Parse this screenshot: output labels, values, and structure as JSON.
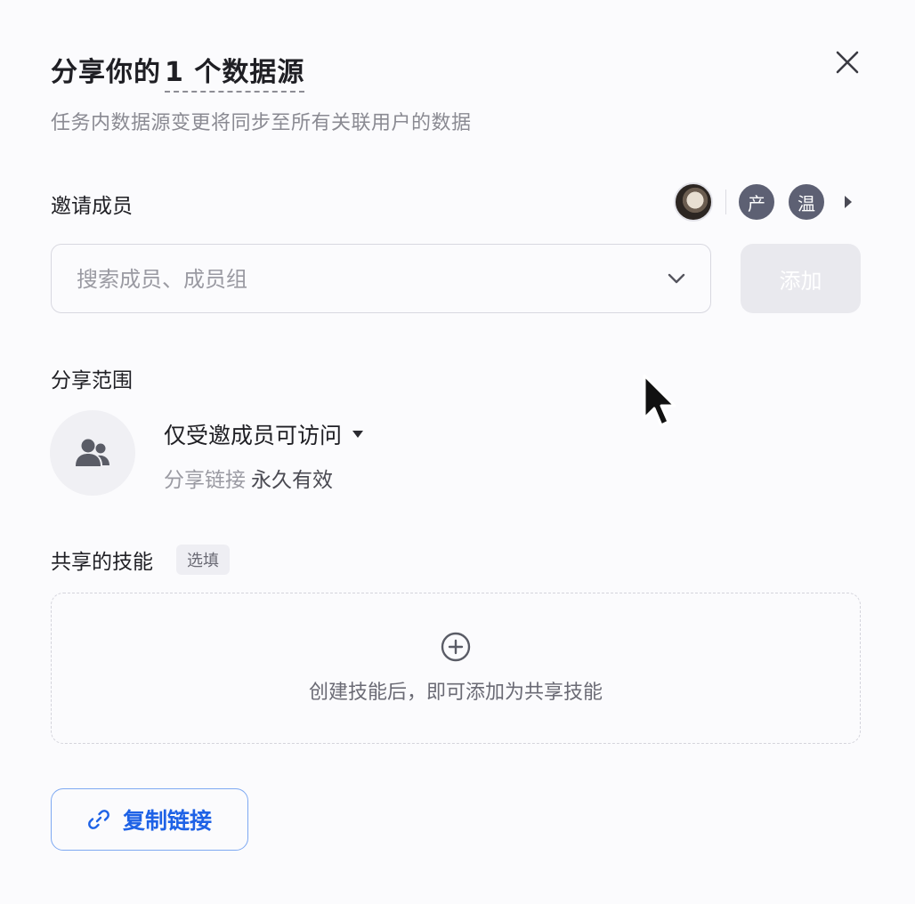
{
  "dialog": {
    "title_prefix": "分享你的",
    "title_count": "1 个数据源",
    "subtitle": "任务内数据源变更将同步至所有关联用户的数据",
    "close_icon": "close-icon"
  },
  "invite": {
    "label": "邀请成员",
    "members": [
      {
        "type": "photo",
        "icon": "user-photo-avatar"
      },
      {
        "type": "letter",
        "text": "产"
      },
      {
        "type": "letter",
        "text": "温"
      }
    ],
    "search_placeholder": "搜索成员、成员组",
    "search_value": "",
    "add_button": "添加",
    "add_button_disabled": true
  },
  "scope": {
    "label": "分享范围",
    "icon": "group-users-icon",
    "access": "仅受邀成员可访问",
    "link_label": "分享链接",
    "link_validity": "永久有效"
  },
  "skills": {
    "label": "共享的技能",
    "optional_badge": "选填",
    "empty_hint": "创建技能后，即可添加为共享技能",
    "add_icon": "plus-circle-icon"
  },
  "footer": {
    "copy_link_button": "复制链接",
    "copy_link_icon": "link-icon"
  },
  "colors": {
    "accent": "#1e62e6",
    "accent_border": "#7ea9f2",
    "avatar_bg": "#5d6073",
    "muted_text": "#9a9aa2"
  }
}
